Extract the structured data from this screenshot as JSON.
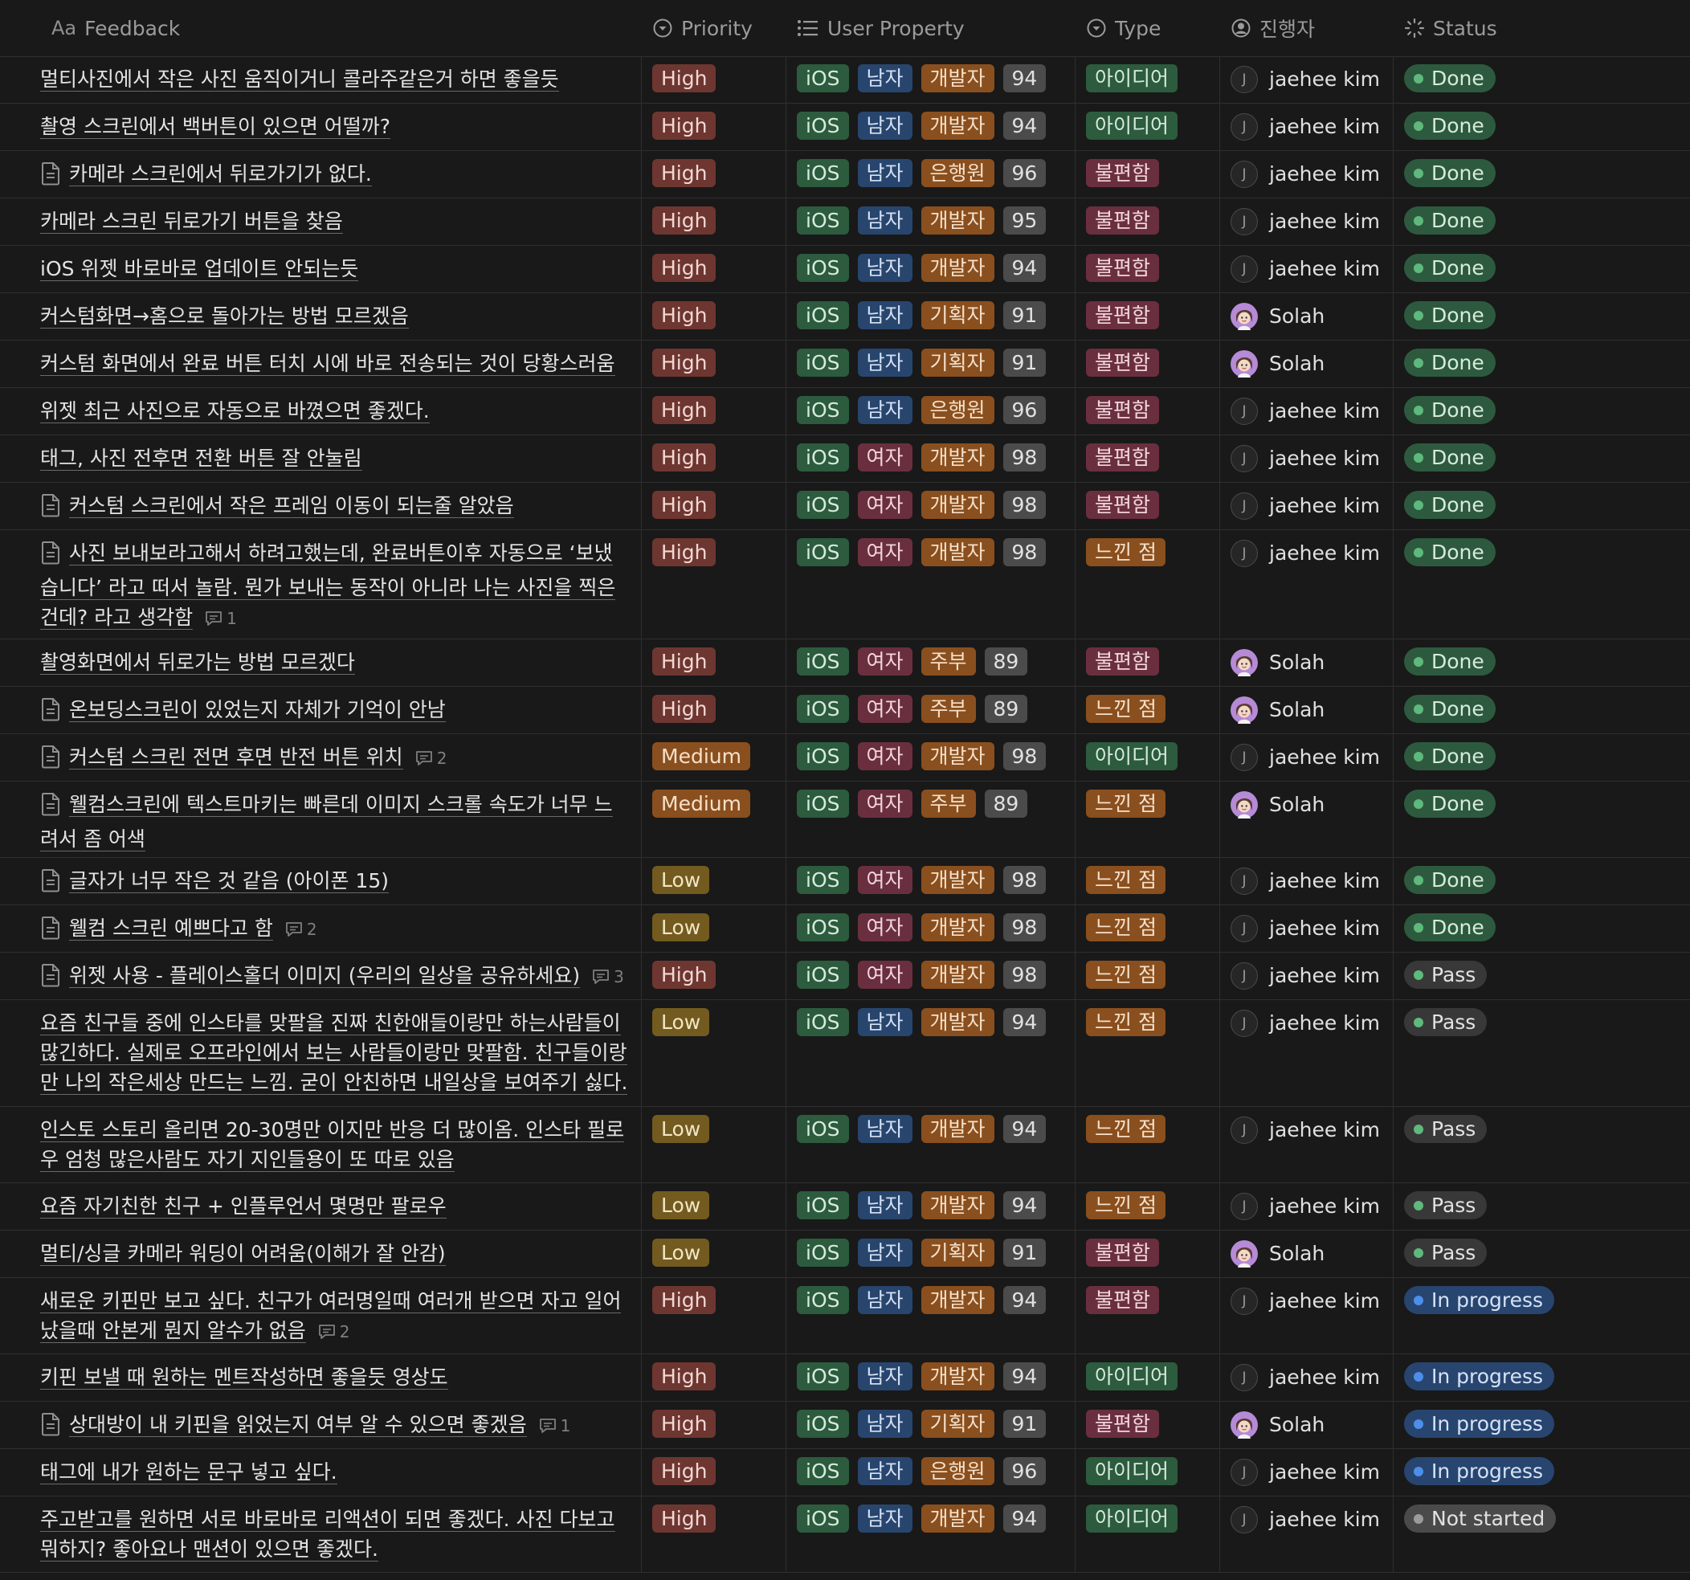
{
  "headers": {
    "feedback": "Feedback",
    "priority": "Priority",
    "user_property": "User Property",
    "type": "Type",
    "assignee": "진행자",
    "status": "Status"
  },
  "rows": [
    {
      "text": "멀티사진에서 작은 사진 움직이거니 콜라주같은거 하면 좋을듯",
      "doc": false,
      "comments": "",
      "priority": "High",
      "os": "iOS",
      "gender": "남자",
      "job": "개발자",
      "score": "94",
      "type": "아이디어",
      "assignee": "jaehee kim",
      "avatar": "J",
      "status": "Done"
    },
    {
      "text": "촬영 스크린에서 백버튼이 있으면 어떨까?",
      "doc": false,
      "comments": "",
      "priority": "High",
      "os": "iOS",
      "gender": "남자",
      "job": "개발자",
      "score": "94",
      "type": "아이디어",
      "assignee": "jaehee kim",
      "avatar": "J",
      "status": "Done"
    },
    {
      "text": "카메라 스크린에서 뒤로가기가 없다.",
      "doc": true,
      "comments": "",
      "priority": "High",
      "os": "iOS",
      "gender": "남자",
      "job": "은행원",
      "score": "96",
      "type": "불편함",
      "assignee": "jaehee kim",
      "avatar": "J",
      "status": "Done"
    },
    {
      "text": "카메라 스크린 뒤로가기 버튼을 찾음",
      "doc": false,
      "comments": "",
      "priority": "High",
      "os": "iOS",
      "gender": "남자",
      "job": "개발자",
      "score": "95",
      "type": "불편함",
      "assignee": "jaehee kim",
      "avatar": "J",
      "status": "Done"
    },
    {
      "text": "iOS 위젯 바로바로 업데이트 안되는듯",
      "doc": false,
      "comments": "",
      "priority": "High",
      "os": "iOS",
      "gender": "남자",
      "job": "개발자",
      "score": "94",
      "type": "불편함",
      "assignee": "jaehee kim",
      "avatar": "J",
      "status": "Done"
    },
    {
      "text": "커스텀화면→홈으로 돌아가는 방법 모르겠음",
      "doc": false,
      "comments": "",
      "priority": "High",
      "os": "iOS",
      "gender": "남자",
      "job": "기획자",
      "score": "91",
      "type": "불편함",
      "assignee": "Solah",
      "avatar": "S",
      "status": "Done"
    },
    {
      "text": "커스텀 화면에서 완료 버튼 터치 시에 바로 전송되는 것이 당황스러움",
      "doc": false,
      "comments": "",
      "priority": "High",
      "os": "iOS",
      "gender": "남자",
      "job": "기획자",
      "score": "91",
      "type": "불편함",
      "assignee": "Solah",
      "avatar": "S",
      "status": "Done"
    },
    {
      "text": "위젯 최근 사진으로 자동으로 바꼈으면 좋겠다.",
      "doc": false,
      "comments": "",
      "priority": "High",
      "os": "iOS",
      "gender": "남자",
      "job": "은행원",
      "score": "96",
      "type": "불편함",
      "assignee": "jaehee kim",
      "avatar": "J",
      "status": "Done"
    },
    {
      "text": "태그, 사진 전후면 전환 버튼 잘 안눌림",
      "doc": false,
      "comments": "",
      "priority": "High",
      "os": "iOS",
      "gender": "여자",
      "job": "개발자",
      "score": "98",
      "type": "불편함",
      "assignee": "jaehee kim",
      "avatar": "J",
      "status": "Done"
    },
    {
      "text": "커스텀 스크린에서 작은 프레임 이동이 되는줄 알았음",
      "doc": true,
      "comments": "",
      "priority": "High",
      "os": "iOS",
      "gender": "여자",
      "job": "개발자",
      "score": "98",
      "type": "불편함",
      "assignee": "jaehee kim",
      "avatar": "J",
      "status": "Done"
    },
    {
      "text": "사진 보내보라고해서 하려고했는데, 완료버튼이후 자동으로 ‘보냈습니다’ 라고 떠서 놀람. 뭔가 보내는 동작이 아니라 나는 사진을 찍은건데? 라고 생각함",
      "doc": true,
      "comments": "1",
      "priority": "High",
      "os": "iOS",
      "gender": "여자",
      "job": "개발자",
      "score": "98",
      "type": "느낀 점",
      "assignee": "jaehee kim",
      "avatar": "J",
      "status": "Done"
    },
    {
      "text": "촬영화면에서 뒤로가는 방법 모르겠다",
      "doc": false,
      "comments": "",
      "priority": "High",
      "os": "iOS",
      "gender": "여자",
      "job": "주부",
      "score": "89",
      "type": "불편함",
      "assignee": "Solah",
      "avatar": "S",
      "status": "Done"
    },
    {
      "text": "온보딩스크린이 있었는지 자체가 기억이 안남",
      "doc": true,
      "comments": "",
      "priority": "High",
      "os": "iOS",
      "gender": "여자",
      "job": "주부",
      "score": "89",
      "type": "느낀 점",
      "assignee": "Solah",
      "avatar": "S",
      "status": "Done"
    },
    {
      "text": "커스텀 스크린 전면 후면 반전 버튼 위치",
      "doc": true,
      "comments": "2",
      "priority": "Medium",
      "os": "iOS",
      "gender": "여자",
      "job": "개발자",
      "score": "98",
      "type": "아이디어",
      "assignee": "jaehee kim",
      "avatar": "J",
      "status": "Done"
    },
    {
      "text": "웰컴스크린에 텍스트마키는 빠른데 이미지 스크롤 속도가 너무 느려서 좀 어색",
      "doc": true,
      "comments": "",
      "priority": "Medium",
      "os": "iOS",
      "gender": "여자",
      "job": "주부",
      "score": "89",
      "type": "느낀 점",
      "assignee": "Solah",
      "avatar": "S",
      "status": "Done"
    },
    {
      "text": "글자가 너무 작은 것 같음 (아이폰 15)",
      "doc": true,
      "comments": "",
      "priority": "Low",
      "os": "iOS",
      "gender": "여자",
      "job": "개발자",
      "score": "98",
      "type": "느낀 점",
      "assignee": "jaehee kim",
      "avatar": "J",
      "status": "Done"
    },
    {
      "text": "웰컴 스크린 예쁘다고 함",
      "doc": true,
      "comments": "2",
      "priority": "Low",
      "os": "iOS",
      "gender": "여자",
      "job": "개발자",
      "score": "98",
      "type": "느낀 점",
      "assignee": "jaehee kim",
      "avatar": "J",
      "status": "Done"
    },
    {
      "text": "위젯 사용 - 플레이스홀더 이미지 (우리의 일상을 공유하세요)",
      "doc": true,
      "comments": "3",
      "priority": "High",
      "os": "iOS",
      "gender": "여자",
      "job": "개발자",
      "score": "98",
      "type": "느낀 점",
      "assignee": "jaehee kim",
      "avatar": "J",
      "status": "Pass"
    },
    {
      "text": "요즘 친구들 중에 인스타를 맞팔을 진짜 친한애들이랑만 하는사람들이 많긴하다. 실제로 오프라인에서 보는 사람들이랑만 맞팔함. 친구들이랑만 나의 작은세상 만드는 느낌. 굳이 안친하면 내일상을 보여주기 싫다.",
      "doc": false,
      "comments": "",
      "priority": "Low",
      "os": "iOS",
      "gender": "남자",
      "job": "개발자",
      "score": "94",
      "type": "느낀 점",
      "assignee": "jaehee kim",
      "avatar": "J",
      "status": "Pass"
    },
    {
      "text": "인스토 스토리 올리면 20-30명만 이지만 반응 더 많이옴. 인스타 필로우 엄청 많은사람도 자기 지인들용이 또 따로 있음",
      "doc": false,
      "comments": "",
      "priority": "Low",
      "os": "iOS",
      "gender": "남자",
      "job": "개발자",
      "score": "94",
      "type": "느낀 점",
      "assignee": "jaehee kim",
      "avatar": "J",
      "status": "Pass"
    },
    {
      "text": "요즘 자기친한 친구 + 인플루언서 몇명만 팔로우",
      "doc": false,
      "comments": "",
      "priority": "Low",
      "os": "iOS",
      "gender": "남자",
      "job": "개발자",
      "score": "94",
      "type": "느낀 점",
      "assignee": "jaehee kim",
      "avatar": "J",
      "status": "Pass"
    },
    {
      "text": "멀티/싱글 카메라 워딩이 어려움(이해가 잘 안감)",
      "doc": false,
      "comments": "",
      "priority": "Low",
      "os": "iOS",
      "gender": "남자",
      "job": "기획자",
      "score": "91",
      "type": "불편함",
      "assignee": "Solah",
      "avatar": "S",
      "status": "Pass"
    },
    {
      "text": "새로운 키핀만 보고 싶다. 친구가 여러명일때  여러개 받으면 자고 일어났을때 안본게 뭔지 알수가 없음",
      "doc": false,
      "comments": "2",
      "priority": "High",
      "os": "iOS",
      "gender": "남자",
      "job": "개발자",
      "score": "94",
      "type": "불편함",
      "assignee": "jaehee kim",
      "avatar": "J",
      "status": "In progress"
    },
    {
      "text": "키핀 보낼 때 원하는 멘트작성하면 좋을듯 영상도",
      "doc": false,
      "comments": "",
      "priority": "High",
      "os": "iOS",
      "gender": "남자",
      "job": "개발자",
      "score": "94",
      "type": "아이디어",
      "assignee": "jaehee kim",
      "avatar": "J",
      "status": "In progress"
    },
    {
      "text": "상대방이 내 키핀을 읽었는지 여부 알 수 있으면 좋겠음",
      "doc": true,
      "comments": "1",
      "priority": "High",
      "os": "iOS",
      "gender": "남자",
      "job": "기획자",
      "score": "91",
      "type": "불편함",
      "assignee": "Solah",
      "avatar": "S",
      "status": "In progress"
    },
    {
      "text": "태그에 내가 원하는 문구 넣고 싶다.",
      "doc": false,
      "comments": "",
      "priority": "High",
      "os": "iOS",
      "gender": "남자",
      "job": "은행원",
      "score": "96",
      "type": "아이디어",
      "assignee": "jaehee kim",
      "avatar": "J",
      "status": "In progress"
    },
    {
      "text": "주고받고를 원하면 서로 바로바로 리액션이 되면 좋겠다. 사진 다보고 뭐하지? 좋아요나 맨션이 있으면 좋겠다.",
      "doc": false,
      "comments": "",
      "priority": "High",
      "os": "iOS",
      "gender": "남자",
      "job": "개발자",
      "score": "94",
      "type": "아이디어",
      "assignee": "jaehee kim",
      "avatar": "J",
      "status": "Not started"
    }
  ]
}
